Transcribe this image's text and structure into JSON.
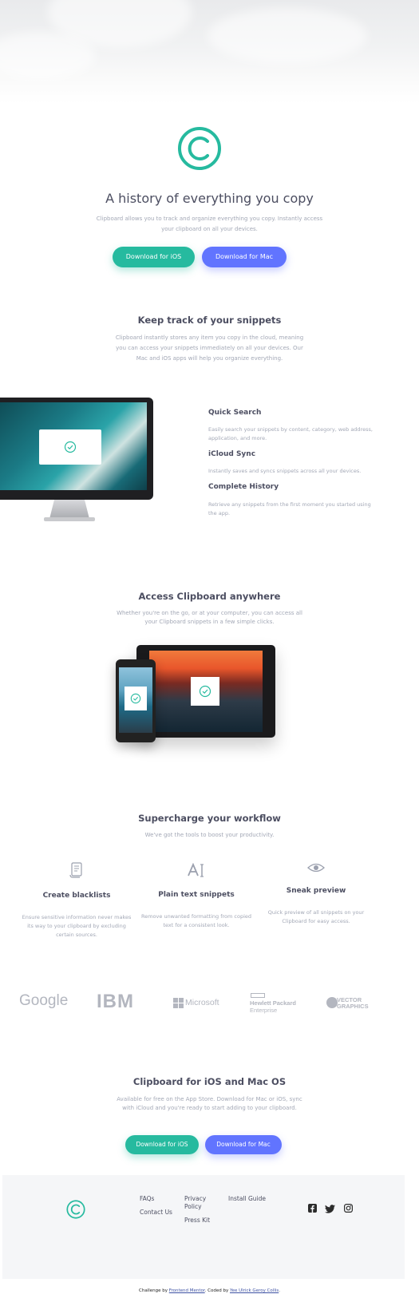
{
  "hero": {
    "title": "A history of everything you copy",
    "description_line1": "Clipboard allows you to track and organize everything you copy. Instantly access",
    "description_line2": "your clipboard on all your devices.",
    "ios_button": "Download for iOS",
    "mac_button": "Download for Mac"
  },
  "snippets": {
    "title": "Keep track of your snippets",
    "line1": "Clipboard instantly stores any item you copy in the cloud, meaning",
    "line2": "you can access your snippets immediately on all your devices. Our",
    "line3": "Mac and iOS apps will help you organize everything.",
    "features": [
      {
        "title": "Quick Search",
        "line1": "Easily search your snippets by content, category, web address,",
        "line2": "application, and more."
      },
      {
        "title": "iCloud Sync",
        "line1": "Instantly saves and syncs snippets across all your devices.",
        "line2": ""
      },
      {
        "title": "Complete History",
        "line1": "Retrieve any snippets from the first moment you started using",
        "line2": "the app."
      }
    ]
  },
  "access": {
    "title": "Access Clipboard anywhere",
    "line1": "Whether you're on the go, or at your computer, you can access all",
    "line2": "your Clipboard snippets in a few simple clicks."
  },
  "workflow": {
    "title": "Supercharge your workflow",
    "subtitle": "We've got the tools to boost your productivity.",
    "items": [
      {
        "icon": "blacklist-icon",
        "title": "Create blacklists",
        "line1": "Ensure sensitive information never makes",
        "line2": "its way to your clipboard by excluding",
        "line3": "certain sources."
      },
      {
        "icon": "text-icon",
        "title": "Plain text snippets",
        "line1": "Remove unwanted formatting from copied",
        "line2": "text for a consistent look.",
        "line3": ""
      },
      {
        "icon": "eye-icon",
        "title": "Sneak preview",
        "line1": "Quick preview of all snippets on your",
        "line2": "Clipboard for easy access.",
        "line3": ""
      }
    ]
  },
  "partners": {
    "google": "Google",
    "ibm": "IBM",
    "microsoft": "Microsoft",
    "hp_line1": "Hewlett Packard",
    "hp_line2": "Enterprise",
    "vector_line1": "VECTOR",
    "vector_line2": "GRAPHICS"
  },
  "cta": {
    "title": "Clipboard for iOS and Mac OS",
    "line1": "Available for free on the App Store. Download for Mac or iOS, sync",
    "line2": "with iCloud and you're ready to start adding to your clipboard.",
    "ios_button": "Download for iOS",
    "mac_button": "Download for Mac"
  },
  "footer": {
    "faqs": "FAQs",
    "contact": "Contact Us",
    "privacy_line1": "Privacy",
    "privacy_line2": "Policy",
    "press": "Press Kit",
    "install": "Install Guide"
  },
  "attribution": {
    "prefix": "Challenge by",
    "frontend": "Frontend Mentor",
    "coded": ". Coded by",
    "author": "Yee Ulrick Geroy Collis",
    "suffix": "."
  },
  "colors": {
    "accent_green": "#26ba9f",
    "accent_blue": "#6174ff",
    "heading": "#4c4e61",
    "muted": "#a3a8b6"
  }
}
